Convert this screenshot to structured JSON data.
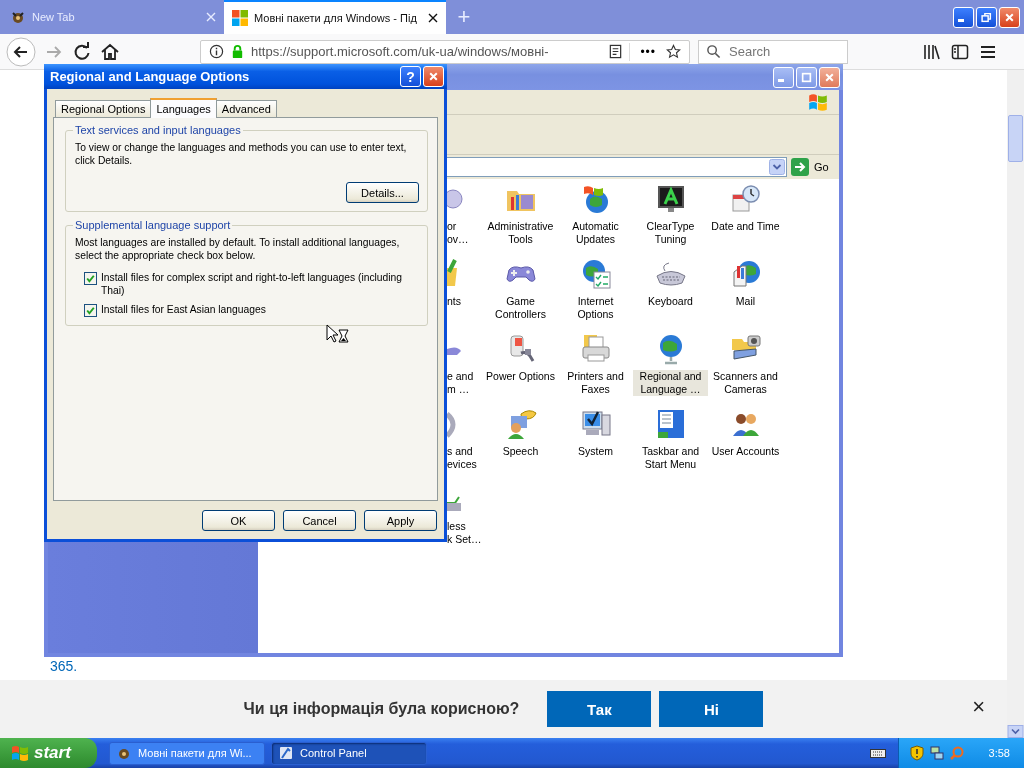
{
  "browser": {
    "tabs": [
      {
        "title": "New Tab",
        "selected": false
      },
      {
        "title": "Мовні пакети для Windows - Під",
        "selected": true
      }
    ],
    "new_tab": "+",
    "address": "https://support.microsoft.com/uk-ua/windows/мовні-",
    "page_actions": "•••",
    "search": {
      "placeholder": "Search"
    }
  },
  "page": {
    "link": "365.",
    "feedback": {
      "question": "Чи ця інформація була корисною?",
      "buttons": [
        "Так",
        "Ні"
      ],
      "close": "×"
    }
  },
  "control_panel": {
    "go": "Go",
    "items": [
      {
        "label": "or\nov…",
        "selected": false
      },
      {
        "label": "Administrative Tools",
        "selected": false
      },
      {
        "label": "Automatic Updates",
        "selected": false
      },
      {
        "label": "ClearType Tuning",
        "selected": false
      },
      {
        "label": "Date and Time",
        "selected": false
      },
      {
        "label": "nts",
        "selected": false
      },
      {
        "label": "Game Controllers",
        "selected": false
      },
      {
        "label": "Internet Options",
        "selected": false
      },
      {
        "label": "Keyboard",
        "selected": false
      },
      {
        "label": "Mail",
        "selected": false
      },
      {
        "label": "e and\nm …",
        "selected": false
      },
      {
        "label": "Power Options",
        "selected": false
      },
      {
        "label": "Printers and Faxes",
        "selected": false
      },
      {
        "label": "Regional and Language …",
        "selected": true
      },
      {
        "label": "Scanners and Cameras",
        "selected": false
      },
      {
        "label": "s and\nevices",
        "selected": false
      },
      {
        "label": "Speech",
        "selected": false
      },
      {
        "label": "System",
        "selected": false
      },
      {
        "label": "Taskbar and Start Menu",
        "selected": false
      },
      {
        "label": "User Accounts",
        "selected": false
      },
      {
        "label": "less\nk Set…",
        "selected": false
      }
    ]
  },
  "dialog": {
    "title": "Regional and Language Options",
    "help": "?",
    "tabs": [
      {
        "label": "Regional Options",
        "selected": false
      },
      {
        "label": "Languages",
        "selected": true
      },
      {
        "label": "Advanced",
        "selected": false
      }
    ],
    "groups": [
      {
        "title": "Text services and input languages",
        "text": "To view or change the languages and methods you can use to enter text, click Details.",
        "button": "Details..."
      },
      {
        "title": "Supplemental language support",
        "text": "Most languages are installed by default. To install additional languages, select the appropriate check box below.",
        "checkboxes": [
          {
            "label": "Install files for complex script and right-to-left languages (including Thai)",
            "checked": true
          },
          {
            "label": "Install files for East Asian languages",
            "checked": true
          }
        ]
      }
    ],
    "buttons": [
      "OK",
      "Cancel",
      "Apply"
    ]
  },
  "taskbar": {
    "start": "start",
    "tasks": [
      {
        "label": "Мовні пакети для Wi...",
        "selected": false
      },
      {
        "label": "Control Panel",
        "selected": true
      }
    ],
    "clock": "3:58"
  }
}
